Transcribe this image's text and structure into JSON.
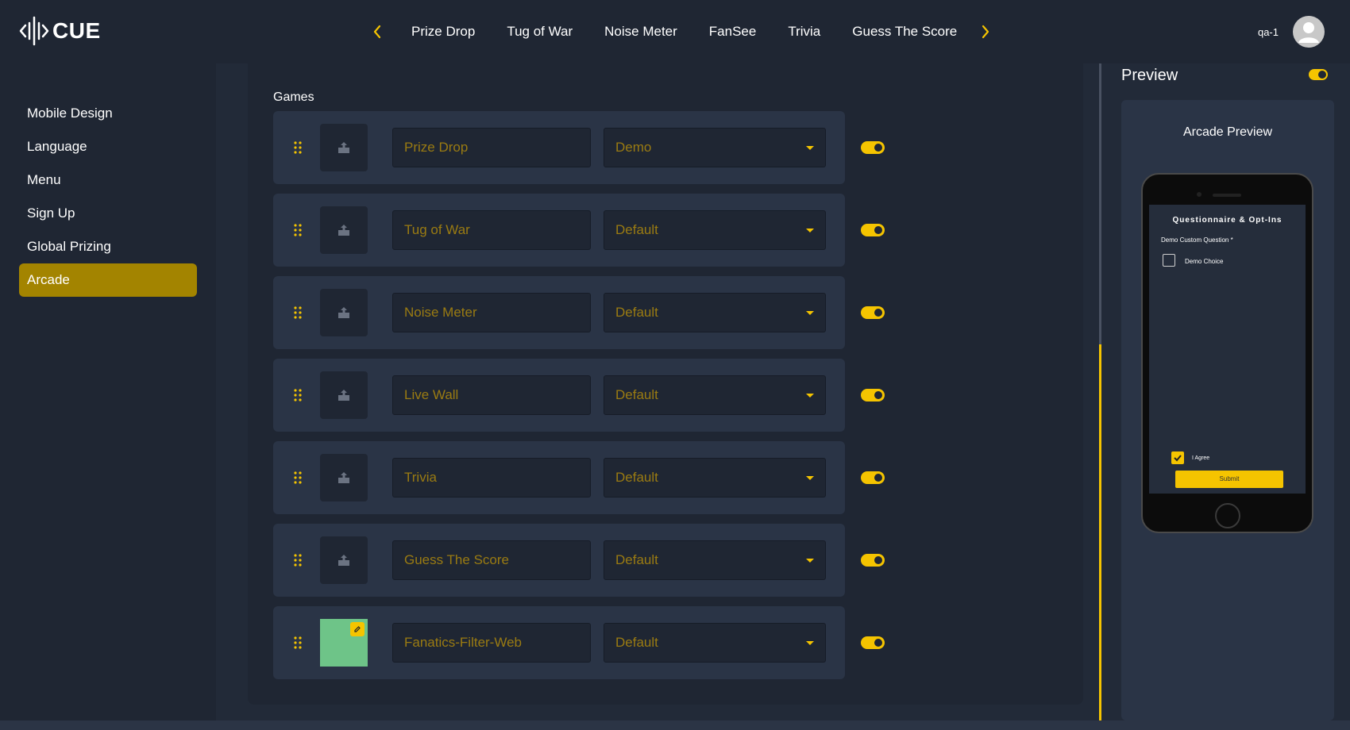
{
  "header": {
    "logo_text": "CUE",
    "tabs": [
      "Prize Drop",
      "Tug of War",
      "Noise Meter",
      "FanSee",
      "Trivia",
      "Guess The Score"
    ],
    "user": "qa-1"
  },
  "sidebar": {
    "items": [
      {
        "label": "Mobile Design"
      },
      {
        "label": "Language"
      },
      {
        "label": "Menu"
      },
      {
        "label": "Sign Up"
      },
      {
        "label": "Global Prizing"
      },
      {
        "label": "Arcade"
      }
    ],
    "active": "Arcade"
  },
  "main": {
    "section_title": "Games",
    "games": [
      {
        "name": "Prize Drop",
        "type": "Demo",
        "enabled": true,
        "has_image": false
      },
      {
        "name": "Tug of War",
        "type": "Default",
        "enabled": true,
        "has_image": false
      },
      {
        "name": "Noise Meter",
        "type": "Default",
        "enabled": true,
        "has_image": false
      },
      {
        "name": "Live Wall",
        "type": "Default",
        "enabled": true,
        "has_image": false
      },
      {
        "name": "Trivia",
        "type": "Default",
        "enabled": true,
        "has_image": false
      },
      {
        "name": "Guess The Score",
        "type": "Default",
        "enabled": true,
        "has_image": false
      },
      {
        "name": "Fanatics-Filter-Web",
        "type": "Default",
        "enabled": true,
        "has_image": true
      }
    ]
  },
  "preview": {
    "title": "Preview",
    "enabled": true,
    "label": "Arcade Preview",
    "screen": {
      "heading": "Questionnaire & Opt-Ins",
      "question": "Demo Custom Question *",
      "choice": "Demo Choice",
      "agree": "I Agree",
      "submit": "Submit"
    }
  },
  "colors": {
    "accent": "#f5c400",
    "active_nav": "#a38400",
    "placeholder_text": "#9a7b12",
    "background": "#222a38",
    "panel": "#1f2633",
    "card": "#2a3446"
  }
}
